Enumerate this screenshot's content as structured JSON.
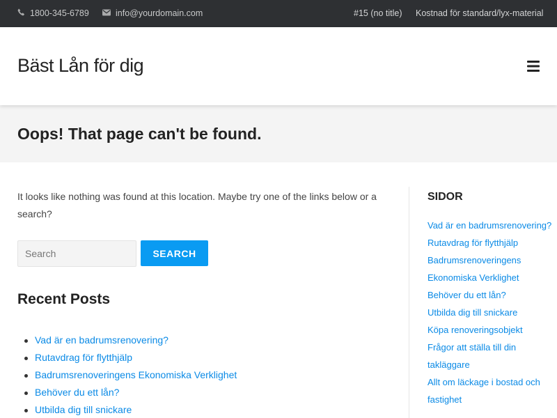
{
  "topbar": {
    "phone": "1800-345-6789",
    "email": "info@yourdomain.com",
    "phone_icon": "phone-icon",
    "email_icon": "envelope-icon",
    "menu": [
      "#15 (no title)",
      "Kostnad för standard/lyx-material"
    ]
  },
  "header": {
    "site_title": "Bäst Lån för dig",
    "menu_icon": "hamburger-menu-icon"
  },
  "page": {
    "title": "Oops! That page can't be found.",
    "intro": "It looks like nothing was found at this location. Maybe try one of the links below or a search?"
  },
  "search": {
    "placeholder": "Search",
    "value": "",
    "button_label": "SEARCH"
  },
  "recent_posts": {
    "heading": "Recent Posts",
    "items": [
      "Vad är en badrumsrenovering?",
      "Rutavdrag för flytthjälp",
      "Badrumsrenoveringens Ekonomiska Verklighet",
      "Behöver du ett lån?",
      "Utbilda dig till snickare"
    ]
  },
  "sidebar": {
    "heading": "SIDOR",
    "items": [
      "Vad är en badrumsrenovering?",
      "Rutavdrag för flytthjälp",
      "Badrumsrenoveringens Ekonomiska Verklighet",
      "Behöver du ett lån?",
      "Utbilda dig till snickare",
      "Köpa renoveringsobjekt",
      "Frågor att ställa till din takläggare",
      "Allt om läckage i bostad och fastighet"
    ]
  },
  "colors": {
    "topbar_bg": "#2e3033",
    "accent": "#0a9bf2",
    "link": "#0a8ae6",
    "title_band_bg": "#f4f4f4"
  }
}
